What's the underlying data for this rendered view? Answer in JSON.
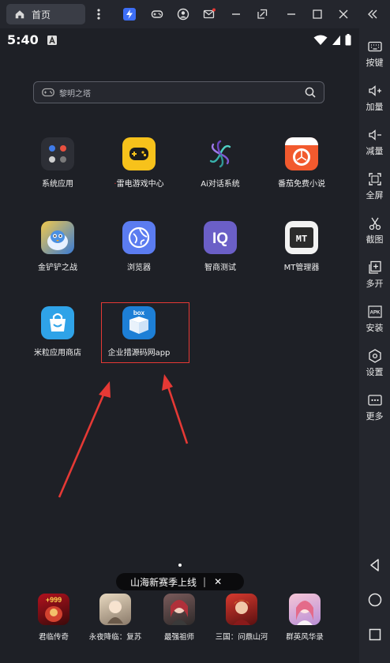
{
  "topbar": {
    "home_tab_label": "首页",
    "icons": [
      "home-icon",
      "more-vertical-icon",
      "bolt-app-icon",
      "gamepad-icon",
      "account-icon",
      "mail-icon",
      "minimize-icon",
      "restore-icon",
      "maximize-icon",
      "close-icon",
      "collapse-icon"
    ]
  },
  "statusbar": {
    "time": "5:40"
  },
  "search": {
    "placeholder": "黎明之塔"
  },
  "desktop": {
    "apps": [
      {
        "label": "系统应用",
        "icon": "system-apps-folder-icon"
      },
      {
        "label": "雷电游戏中心",
        "icon": "game-center-icon"
      },
      {
        "label": "Ai对话系统",
        "icon": "ai-chat-icon"
      },
      {
        "label": "番茄免费小说",
        "icon": "tomato-novel-icon"
      },
      {
        "label": "金铲铲之战",
        "icon": "golden-spatula-icon"
      },
      {
        "label": "浏览器",
        "icon": "browser-icon"
      },
      {
        "label": "智商测试",
        "icon": "iq-test-icon"
      },
      {
        "label": "MT管理器",
        "icon": "mt-manager-icon"
      },
      {
        "label": "米粒应用商店",
        "icon": "mili-store-icon"
      },
      {
        "label": "企业措源码网app",
        "icon": "box-app-icon",
        "badge": "box"
      }
    ]
  },
  "toast": {
    "text": "山海新赛季上线",
    "close": "✕"
  },
  "dock": {
    "apps": [
      {
        "label": "君临传奇",
        "badge": "+999"
      },
      {
        "label": "永夜降临：复苏"
      },
      {
        "label": "最强祖师"
      },
      {
        "label": "三国：问鼎山河"
      },
      {
        "label": "群英风华录"
      }
    ]
  },
  "sidebar": {
    "items": [
      {
        "label": "按键",
        "icon": "keyboard-icon"
      },
      {
        "label": "加量",
        "icon": "volume-up-icon"
      },
      {
        "label": "减量",
        "icon": "volume-down-icon"
      },
      {
        "label": "全屏",
        "icon": "fullscreen-icon"
      },
      {
        "label": "截图",
        "icon": "scissors-icon"
      },
      {
        "label": "多开",
        "icon": "multi-instance-icon"
      },
      {
        "label": "安装",
        "icon": "apk-install-icon",
        "icon_text": "APK"
      },
      {
        "label": "设置",
        "icon": "settings-icon"
      },
      {
        "label": "更多",
        "icon": "more-icon"
      }
    ],
    "nav": [
      "back-icon",
      "home-circle-icon",
      "recents-icon"
    ]
  },
  "colors": {
    "background": "#1e2026",
    "sidebar": "#24262d",
    "highlight": "#e53935",
    "accent_red": "#e53935"
  }
}
